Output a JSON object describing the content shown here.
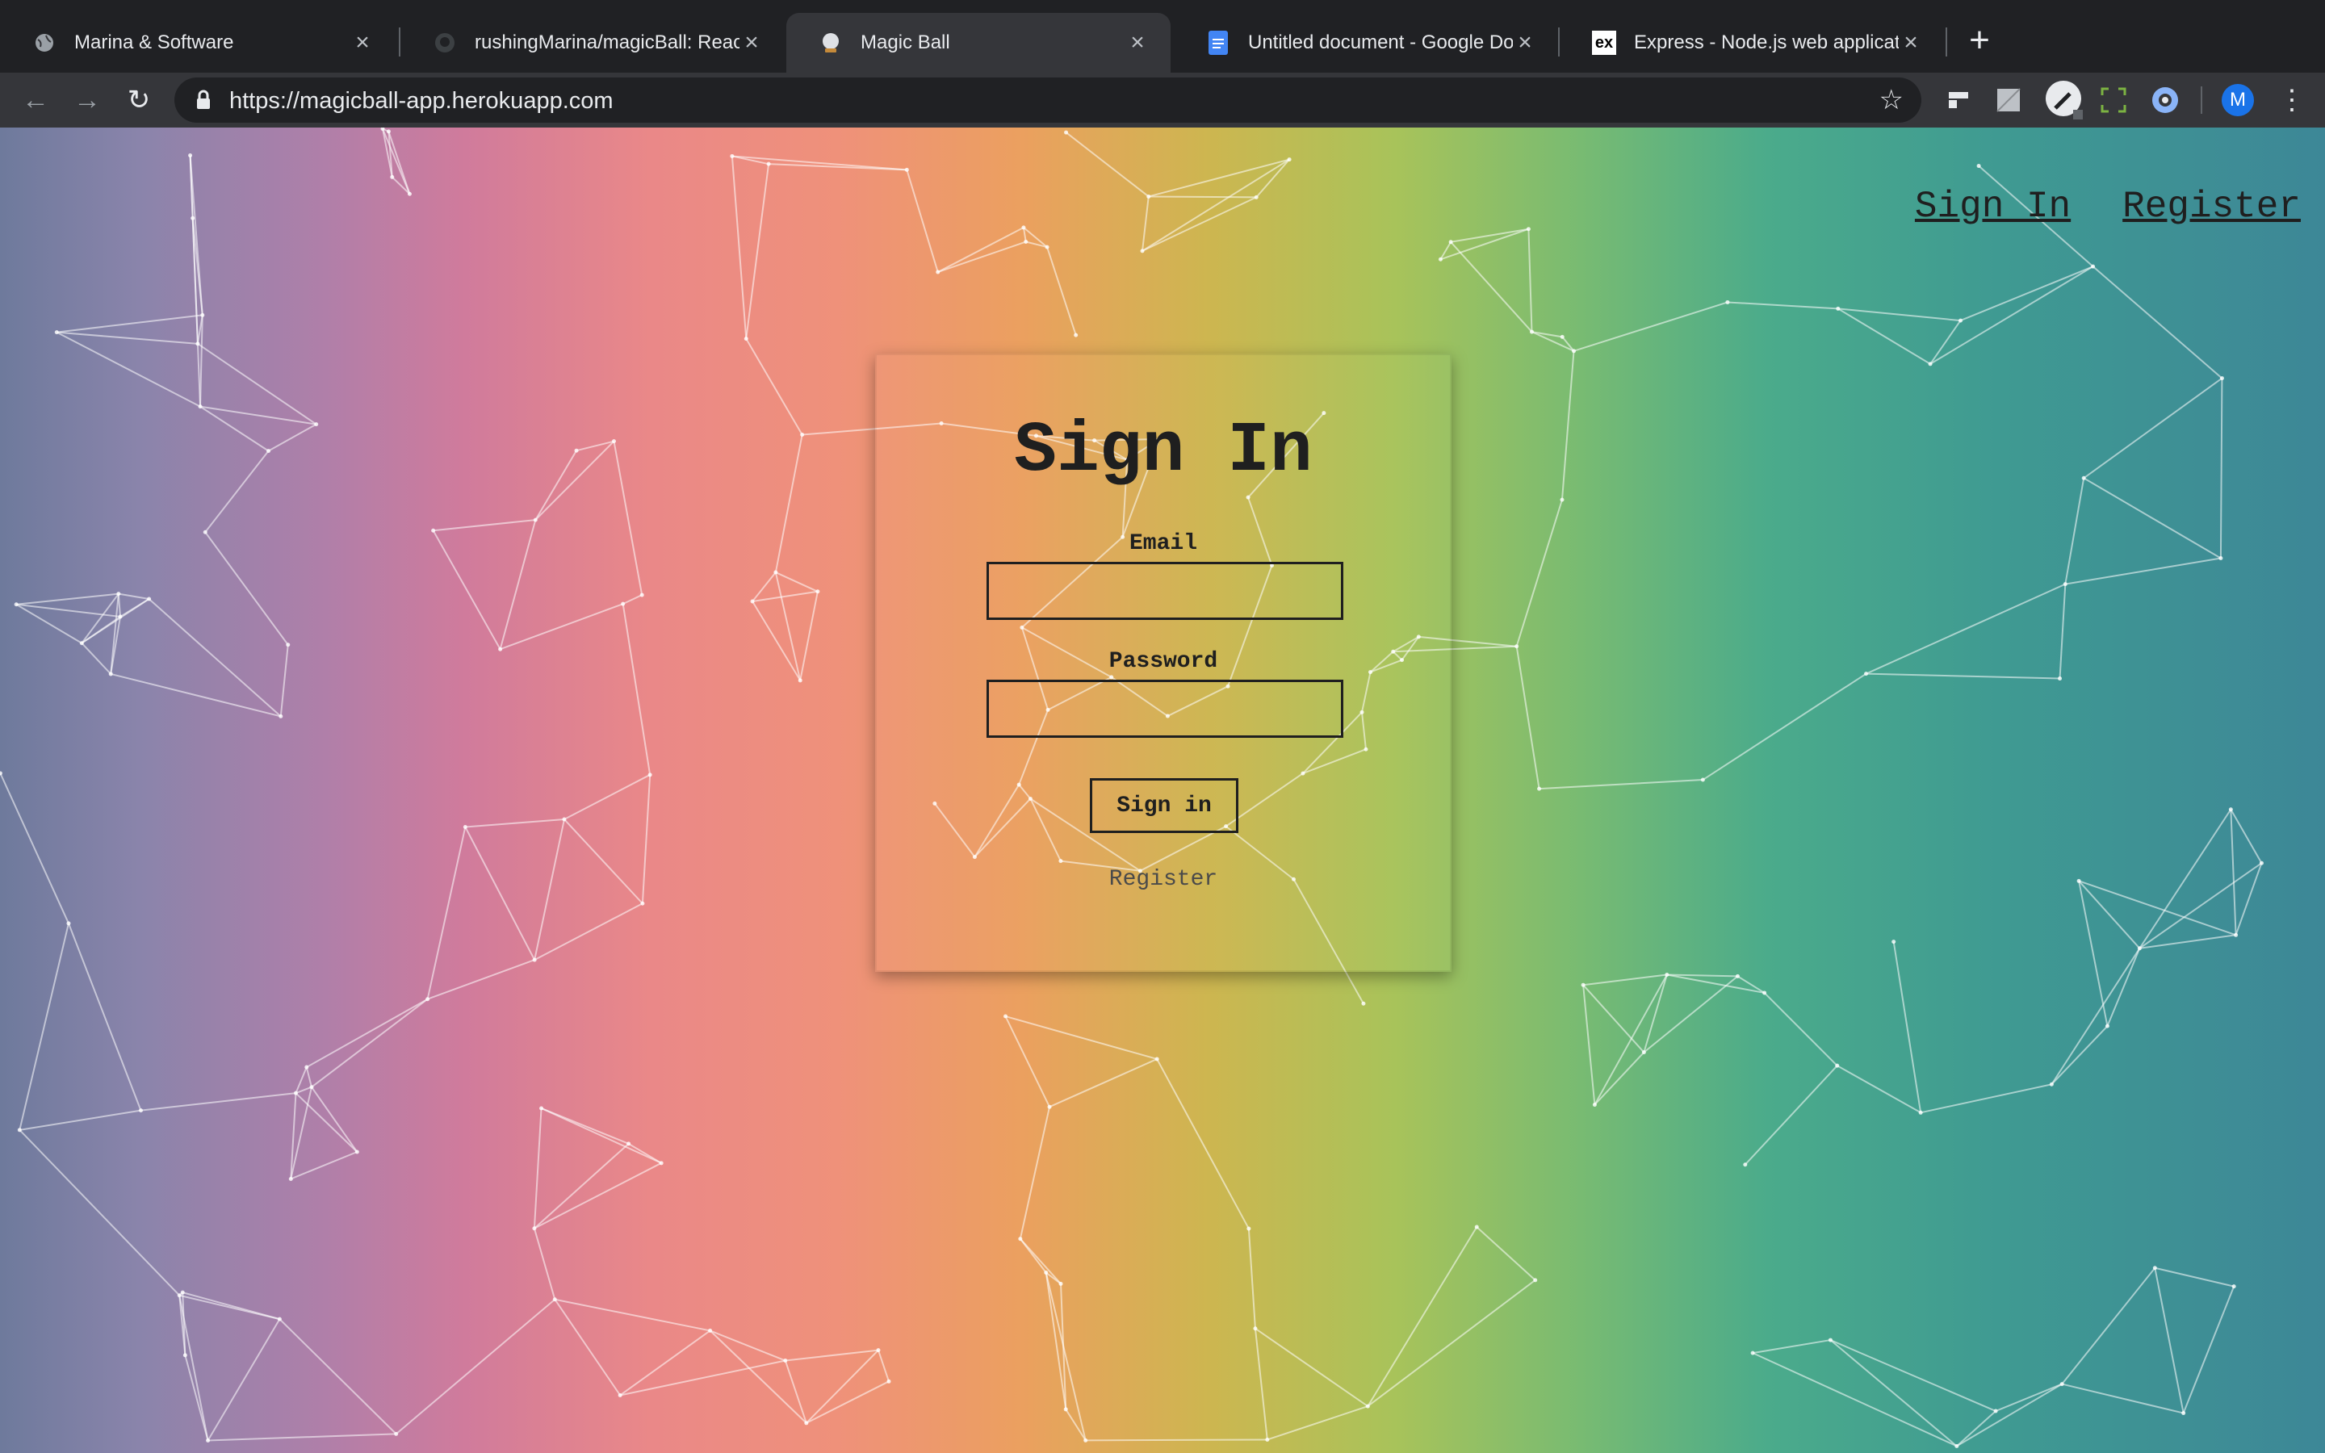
{
  "browser": {
    "tabs": [
      {
        "title": "Marina & Software",
        "favicon": "globe-icon",
        "active": false
      },
      {
        "title": "rushingMarina/magicBall: Reac",
        "favicon": "github-icon",
        "active": false
      },
      {
        "title": "Magic Ball",
        "favicon": "crystal-ball-icon",
        "active": true
      },
      {
        "title": "Untitled document - Google Do",
        "favicon": "google-docs-icon",
        "active": false
      },
      {
        "title": "Express - Node.js web applicat",
        "favicon": "express-icon",
        "active": false
      }
    ],
    "express_favicon_text": "ex",
    "url": "https://magicball-app.herokuapp.com",
    "profile_initial": "M",
    "accent": "#1a73e8"
  },
  "page": {
    "nav": {
      "signin": "Sign In",
      "register": "Register"
    },
    "form": {
      "title": "Sign In",
      "email_label": "Email",
      "email_value": "",
      "password_label": "Password",
      "password_value": "",
      "submit": "Sign in",
      "register_link": "Register"
    }
  }
}
